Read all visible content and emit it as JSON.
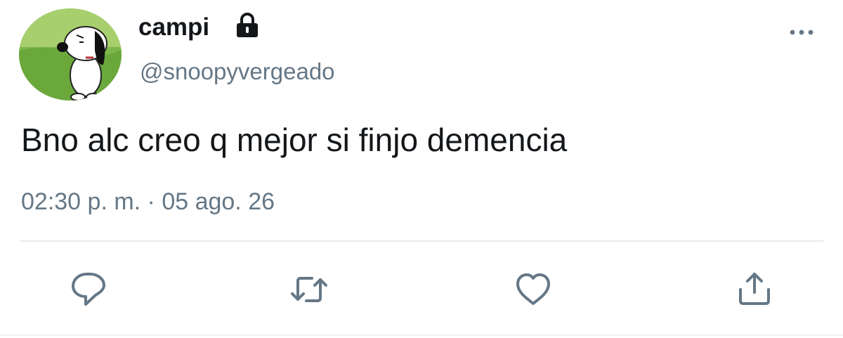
{
  "tweet": {
    "display_name": "campi",
    "protected_icon": "lock-icon",
    "handle": "@snoopyvergeado",
    "text": "Bno alc creo q mejor si finjo demencia",
    "timestamp": "02:30 p. m. · 05 ago. 26"
  },
  "avatar": {
    "icon": "snoopy-avatar"
  },
  "header": {
    "more_icon": "more-dots-icon"
  },
  "actions": [
    {
      "name": "reply",
      "icon": "comment-icon"
    },
    {
      "name": "retweet",
      "icon": "retweet-icon"
    },
    {
      "name": "like",
      "icon": "heart-icon"
    },
    {
      "name": "share",
      "icon": "share-icon"
    }
  ],
  "colors": {
    "text_primary": "#14171a",
    "text_secondary": "#657786",
    "divider": "#e6ecf0",
    "icon": "#657786"
  }
}
